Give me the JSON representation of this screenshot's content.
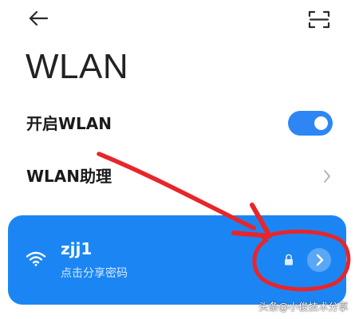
{
  "header": {
    "back_icon": "arrow-left-icon",
    "scan_icon": "scan-icon",
    "title": "WLAN"
  },
  "settings": {
    "enable_wlan": {
      "label": "开启WLAN",
      "toggle_on": true,
      "toggle_color": "#2e86f5"
    },
    "wlan_assistant": {
      "label": "WLAN助理",
      "chevron_icon": "chevron-right-icon"
    }
  },
  "network": {
    "ssid": "zjj1",
    "subtitle": "点击分享密码",
    "signal_icon": "wifi-icon",
    "lock_icon": "lock-icon",
    "detail_icon": "chevron-right-icon",
    "card_color": "#1b86f3"
  },
  "annotation": {
    "color": "#e8252b",
    "arrow": "red-arrow",
    "circle": "red-circle"
  },
  "watermark": "头条@小俊技术分享"
}
